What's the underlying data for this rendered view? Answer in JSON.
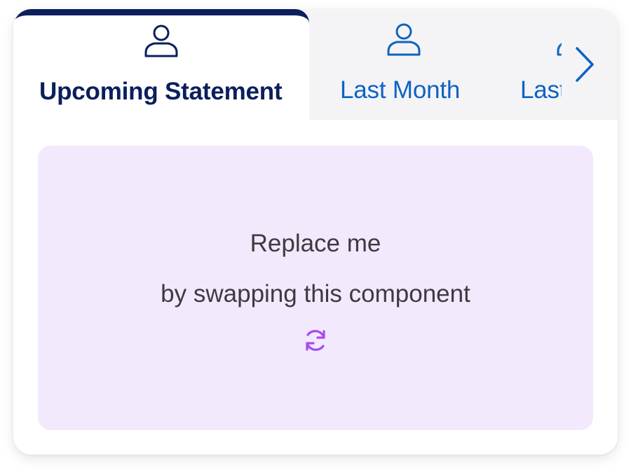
{
  "tabs": [
    {
      "label": "Upcoming Statement",
      "icon": "person-icon",
      "active": true
    },
    {
      "label": "Last Month",
      "icon": "person-icon",
      "active": false
    },
    {
      "label": "Last",
      "icon": "person-icon",
      "active": false
    }
  ],
  "scroll_button": {
    "icon": "chevron-right-icon"
  },
  "placeholder": {
    "title": "Replace me",
    "subtitle": "by swapping this component",
    "icon": "refresh-icon"
  },
  "colors": {
    "active_tab_text": "#0b1f5c",
    "inactive_tab_text": "#0e63c2",
    "placeholder_bg": "#f2e9fd",
    "swap_icon": "#a64bf4"
  }
}
